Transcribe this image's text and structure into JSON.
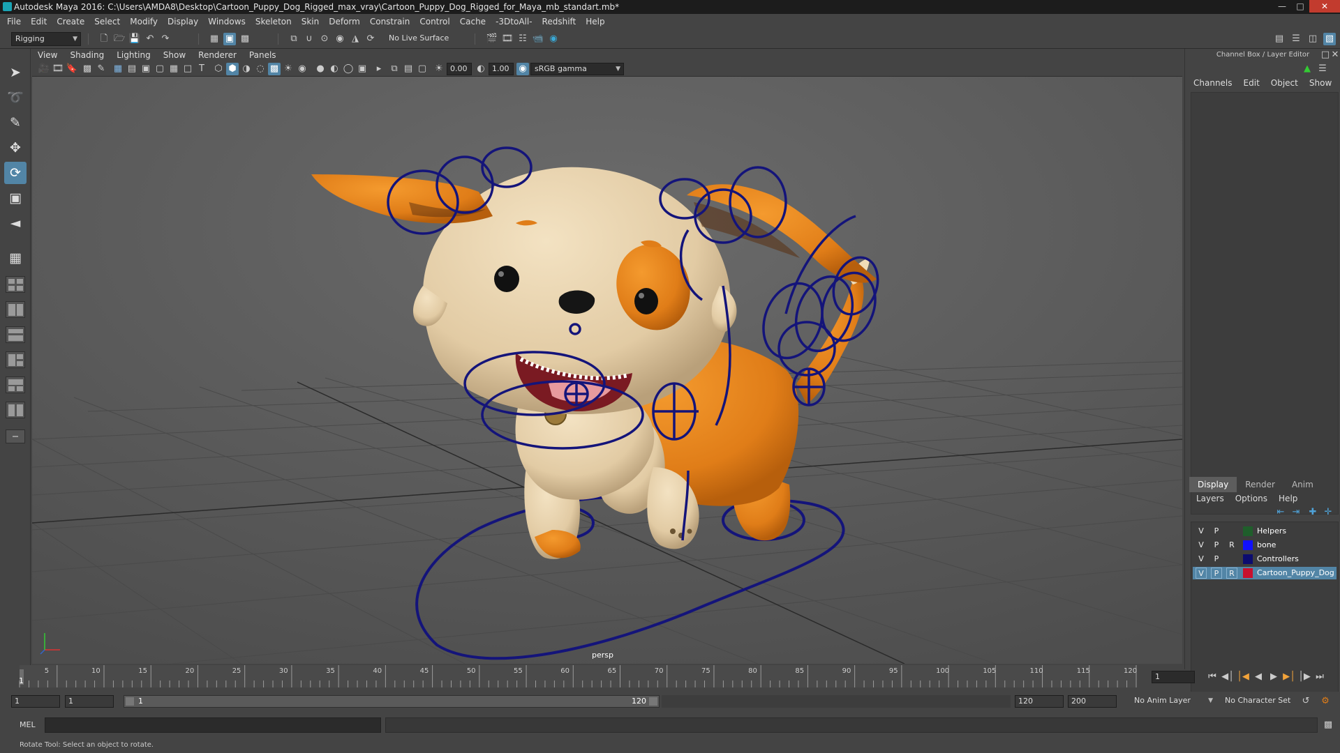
{
  "window": {
    "title": "Autodesk Maya 2016: C:\\Users\\AMDA8\\Desktop\\Cartoon_Puppy_Dog_Rigged_max_vray\\Cartoon_Puppy_Dog_Rigged_for_Maya_mb_standart.mb*"
  },
  "menubar": [
    "File",
    "Edit",
    "Create",
    "Select",
    "Modify",
    "Display",
    "Windows",
    "Skeleton",
    "Skin",
    "Deform",
    "Constrain",
    "Control",
    "Cache",
    "-3DtoAll-",
    "Redshift",
    "Help"
  ],
  "shelf": {
    "mode": "Rigging",
    "live_surface": "No Live Surface"
  },
  "viewport": {
    "menu": [
      "View",
      "Shading",
      "Lighting",
      "Show",
      "Renderer",
      "Panels"
    ],
    "exposure": "0.00",
    "gamma": "1.00",
    "color_space": "sRGB gamma",
    "camera": "persp"
  },
  "channel_box": {
    "title": "Channel Box / Layer Editor",
    "menu": [
      "Channels",
      "Edit",
      "Object",
      "Show"
    ]
  },
  "layer_editor": {
    "tabs": [
      "Display",
      "Render",
      "Anim"
    ],
    "active_tab": "Display",
    "menu": [
      "Layers",
      "Options",
      "Help"
    ],
    "layers": [
      {
        "v": "V",
        "p": "P",
        "r": "",
        "name": "Helpers",
        "color": "#1f5e2b",
        "selected": false
      },
      {
        "v": "V",
        "p": "P",
        "r": "R",
        "name": "bone",
        "color": "#1010ff",
        "selected": false
      },
      {
        "v": "V",
        "p": "P",
        "r": "",
        "name": "Controllers",
        "color": "#0c0c70",
        "selected": false
      },
      {
        "v": "V",
        "p": "P",
        "r": "R",
        "name": "Cartoon_Puppy_Dog",
        "color": "#c8102e",
        "selected": true
      }
    ]
  },
  "timeline": {
    "ticks": [
      "5",
      "10",
      "15",
      "20",
      "25",
      "30",
      "35",
      "40",
      "45",
      "50",
      "55",
      "60",
      "65",
      "70",
      "75",
      "80",
      "85",
      "90",
      "95",
      "100",
      "105",
      "110",
      "115",
      "120"
    ],
    "first_label": "1",
    "current_frame": "1"
  },
  "range": {
    "start": "1",
    "playback_start": "1",
    "slider_start": "1",
    "slider_end": "120",
    "playback_end": "120",
    "end": "200",
    "anim_layer": "No Anim Layer",
    "character_set": "No Character Set"
  },
  "command_line": {
    "lang": "MEL"
  },
  "help_line": {
    "text": "Rotate Tool: Select an object to rotate."
  },
  "colors": {
    "accent": "#5285a6",
    "rig_controls": "#14147a",
    "puppy_orange": "#e9831c",
    "puppy_cream": "#e8d2ad"
  }
}
